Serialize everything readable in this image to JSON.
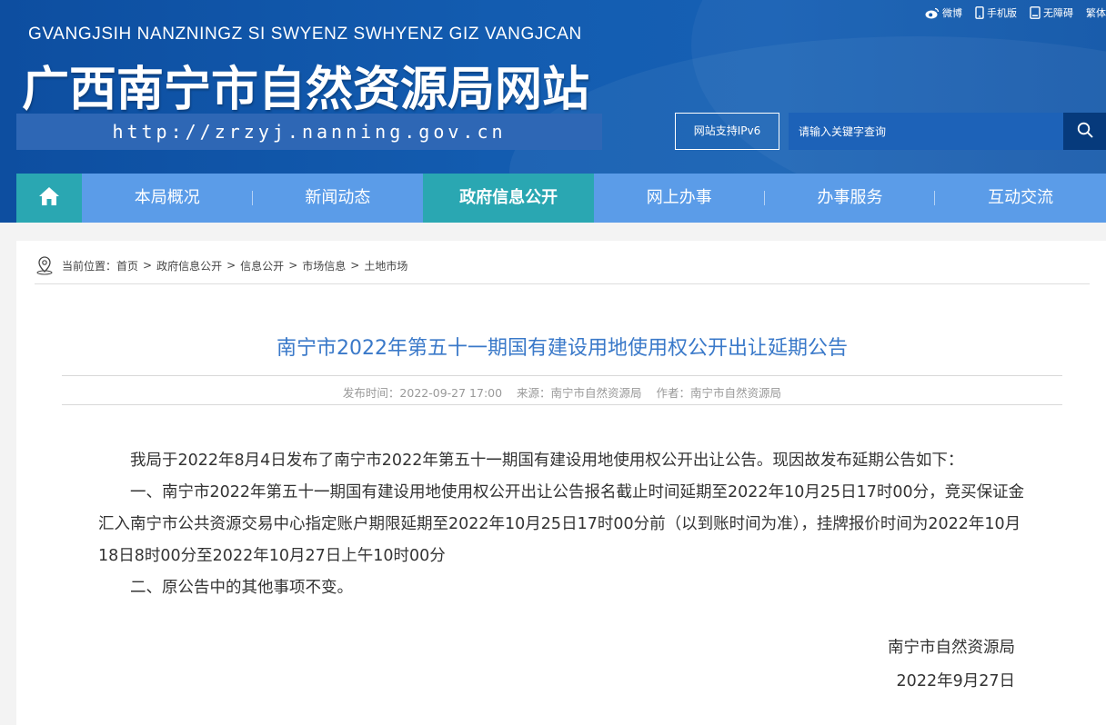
{
  "header": {
    "top_links": [
      {
        "icon": "weibo-icon",
        "label": "微博"
      },
      {
        "icon": "mobile-icon",
        "label": "手机版"
      },
      {
        "icon": "accessibility-icon",
        "label": "无障碍"
      },
      {
        "icon": "",
        "label": "繁体"
      }
    ],
    "pinyin": "GVANGJSIH NANZNINGZ SI SWYENZ SWHYENZ GIZ VANGJCAN",
    "title": "广西南宁市自然资源局网站",
    "url": "http://zrzyj.nanning.gov.cn",
    "ipv6_label": "网站支持IPv6",
    "search_placeholder": "请输入关键字查询"
  },
  "nav": {
    "home_icon": "home-icon",
    "items": [
      {
        "label": "本局概况",
        "active": false
      },
      {
        "label": "新闻动态",
        "active": false
      },
      {
        "label": "政府信息公开",
        "active": true
      },
      {
        "label": "网上办事",
        "active": false
      },
      {
        "label": "办事服务",
        "active": false
      },
      {
        "label": "互动交流",
        "active": false
      }
    ]
  },
  "breadcrumb": {
    "prefix": "当前位置：",
    "items": [
      "首页",
      "政府信息公开",
      "信息公开",
      "市场信息",
      "土地市场"
    ]
  },
  "article": {
    "title": "南宁市2022年第五十一期国有建设用地使用权公开出让延期公告",
    "meta": {
      "publish_time": "发布时间：2022-09-27 17:00",
      "source": "来源：南宁市自然资源局",
      "author": "作者：南宁市自然资源局"
    },
    "paragraphs": [
      "我局于2022年8月4日发布了南宁市2022年第五十一期国有建设用地使用权公开出让公告。现因故发布延期公告如下：",
      "一、南宁市2022年第五十一期国有建设用地使用权公开出让公告报名截止时间延期至2022年10月25日17时00分，竞买保证金汇入南宁市公共资源交易中心指定账户期限延期至2022年10月25日17时00分前（以到账时间为准），挂牌报价时间为2022年10月18日8时00分至2022年10月27日上午10时00分",
      "二、原公告中的其他事项不变。"
    ],
    "signature": "南宁市自然资源局",
    "date": "2022年9月27日"
  },
  "colors": {
    "header_blue": "#0d4ea0",
    "nav_blue": "#5b9ce8",
    "nav_active_teal": "#2aa7b2",
    "title_blue": "#3a79c9"
  }
}
